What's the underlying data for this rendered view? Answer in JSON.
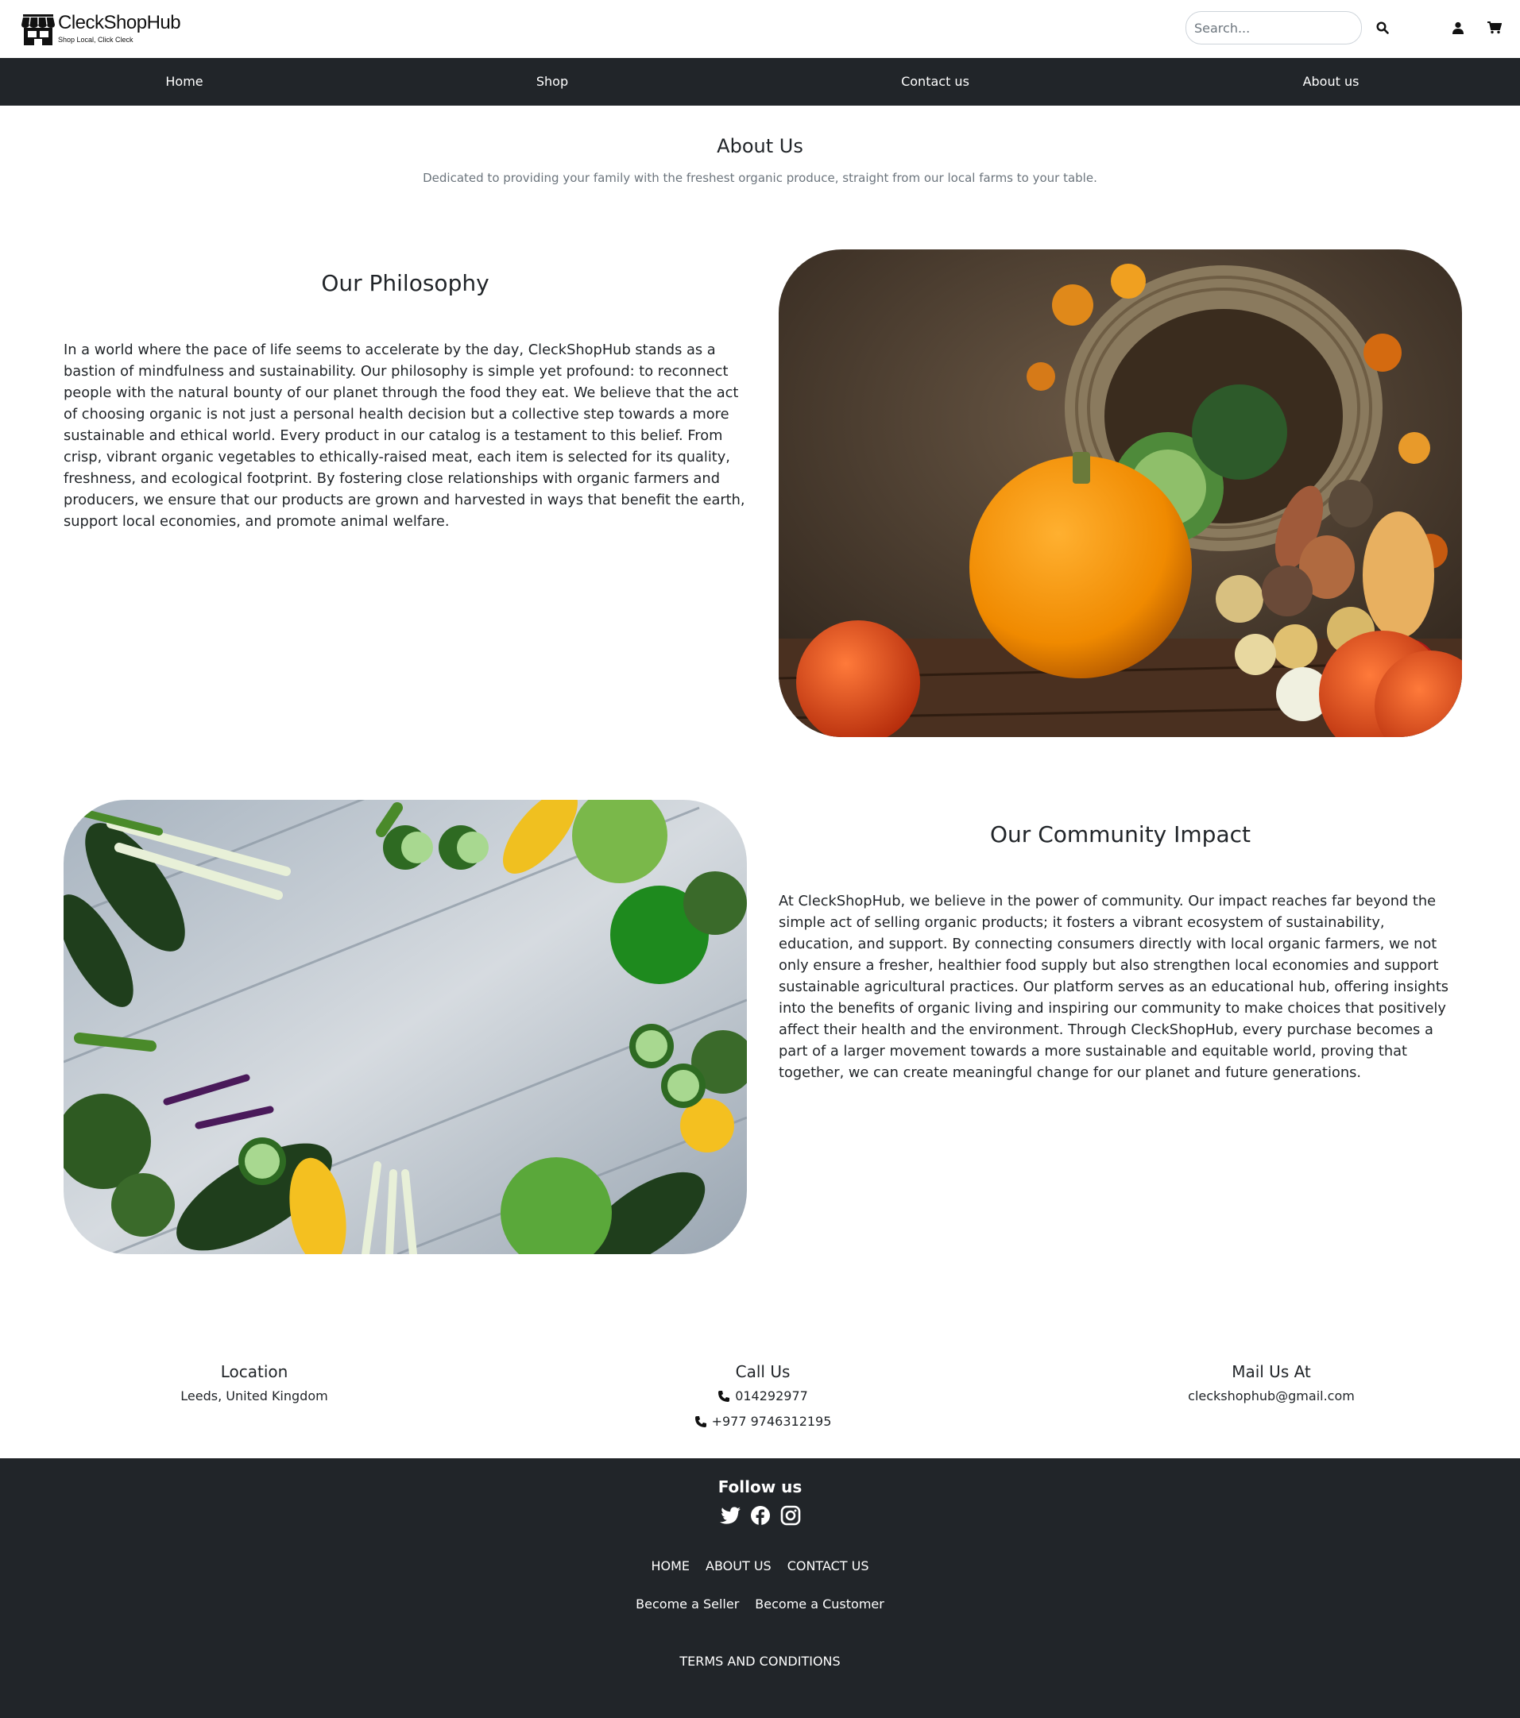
{
  "header": {
    "brand_name": "CleckShopHub",
    "brand_tagline": "Shop Local, Click Cleck",
    "search_placeholder": "Search...",
    "icons": [
      "search-icon",
      "user-icon",
      "cart-icon"
    ]
  },
  "nav": {
    "items": [
      {
        "label": "Home"
      },
      {
        "label": "Shop"
      },
      {
        "label": "Contact us"
      },
      {
        "label": "About us"
      }
    ]
  },
  "about": {
    "title": "About Us",
    "subtitle": "Dedicated to providing your family with the freshest organic produce, straight from our local farms to your table."
  },
  "philosophy": {
    "title": "Our Philosophy",
    "text": "In a world where the pace of life seems to accelerate by the day, CleckShopHub stands as a bastion of mindfulness and sustainability. Our philosophy is simple yet profound: to reconnect people with the natural bounty of our planet through the food they eat. We believe that the act of choosing organic is not just a personal health decision but a collective step towards a more sustainable and ethical world. Every product in our catalog is a testament to this belief. From crisp, vibrant organic vegetables to ethically-raised meat, each item is selected for its quality, freshness, and ecological footprint. By fostering close relationships with organic farmers and producers, we ensure that our products are grown and harvested in ways that benefit the earth, support local economies, and promote animal welfare."
  },
  "community": {
    "title": "Our Community Impact",
    "text": "At CleckShopHub, we believe in the power of community. Our impact reaches far beyond the simple act of selling organic products; it fosters a vibrant ecosystem of sustainability, education, and support. By connecting consumers directly with local organic farmers, we not only ensure a fresher, healthier food supply but also strengthen local economies and support sustainable agricultural practices. Our platform serves as an educational hub, offering insights into the benefits of organic living and inspiring our community to make choices that positively affect their health and the environment. Through CleckShopHub, every purchase becomes a part of a larger movement towards a more sustainable and equitable world, proving that together, we can create meaningful change for our planet and future generations."
  },
  "contact": {
    "location": {
      "title": "Location",
      "value": "Leeds, United Kingdom"
    },
    "call": {
      "title": "Call Us",
      "phones": [
        "014292977",
        "+977 9746312195"
      ]
    },
    "mail": {
      "title": "Mail Us At",
      "value": "cleckshophub@gmail.com"
    }
  },
  "footer": {
    "follow_title": "Follow us",
    "social_icons": [
      "twitter-icon",
      "facebook-icon",
      "instagram-icon"
    ],
    "links": [
      "HOME",
      "ABOUT US",
      "CONTACT US"
    ],
    "role_links": [
      "Become a Seller",
      "Become a Customer"
    ],
    "terms": "TERMS AND CONDITIONS"
  },
  "colors": {
    "navbar_bg": "#212529",
    "footer_bg": "#212529",
    "text": "#212529",
    "muted_text": "#6c757d"
  }
}
